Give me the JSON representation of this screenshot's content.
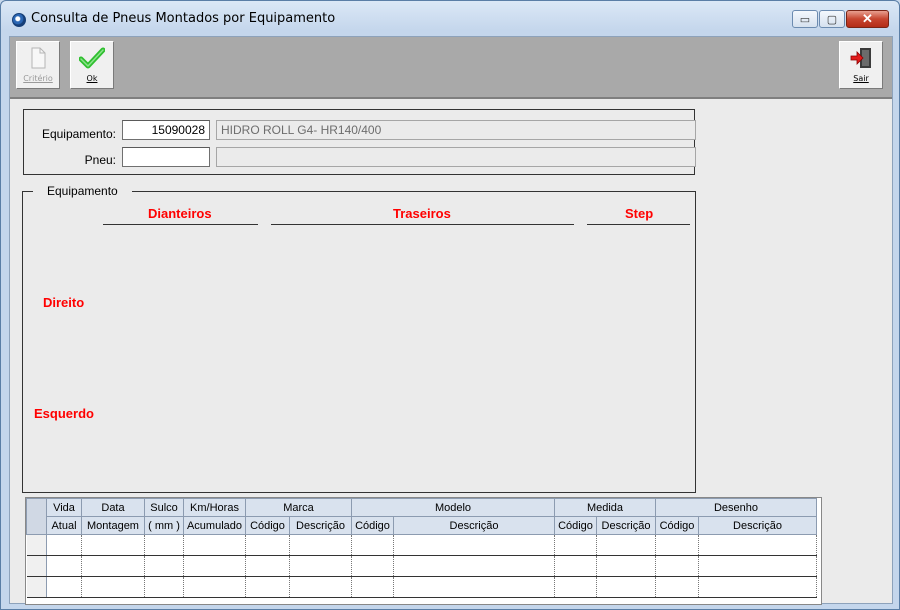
{
  "window": {
    "title": "Consulta de Pneus Montados por Equipamento",
    "buttons": {
      "minimize": "▭",
      "maximize": "▢",
      "close": "✕"
    }
  },
  "toolbar": {
    "criterio_label": "Critério",
    "ok_label": "Ok",
    "sair_label": "Sair",
    "icons": {
      "criterio": "document-icon",
      "ok": "checkmark-icon",
      "sair": "exit-door-icon"
    }
  },
  "form": {
    "equipamento_label": "Equipamento:",
    "equipamento_value": "15090028",
    "equipamento_desc": "HIDRO ROLL G4- HR140/400",
    "pneu_label": "Pneu:",
    "pneu_value": "",
    "pneu_desc": ""
  },
  "group": {
    "legend": "Equipamento",
    "dianteiros": "Dianteiros",
    "traseiros": "Traseiros",
    "step": "Step",
    "direito": "Direito",
    "esquerdo": "Esquerdo"
  },
  "grid": {
    "headers_top": [
      "Vida",
      "Data",
      "Sulco",
      "Km/Horas",
      "Marca",
      "Modelo",
      "Medida",
      "Desenho"
    ],
    "headers_bottom": [
      "Atual",
      "Montagem",
      "( mm )",
      "Acumulado",
      "Código",
      "Descrição",
      "Código",
      "Descrição",
      "Código",
      "Descrição",
      "Código",
      "Descrição"
    ],
    "rows": 3
  },
  "colors": {
    "accent_red": "#ff0000",
    "toolbar_gray": "#a9a9a9",
    "grid_header": "#d9e2ee"
  }
}
